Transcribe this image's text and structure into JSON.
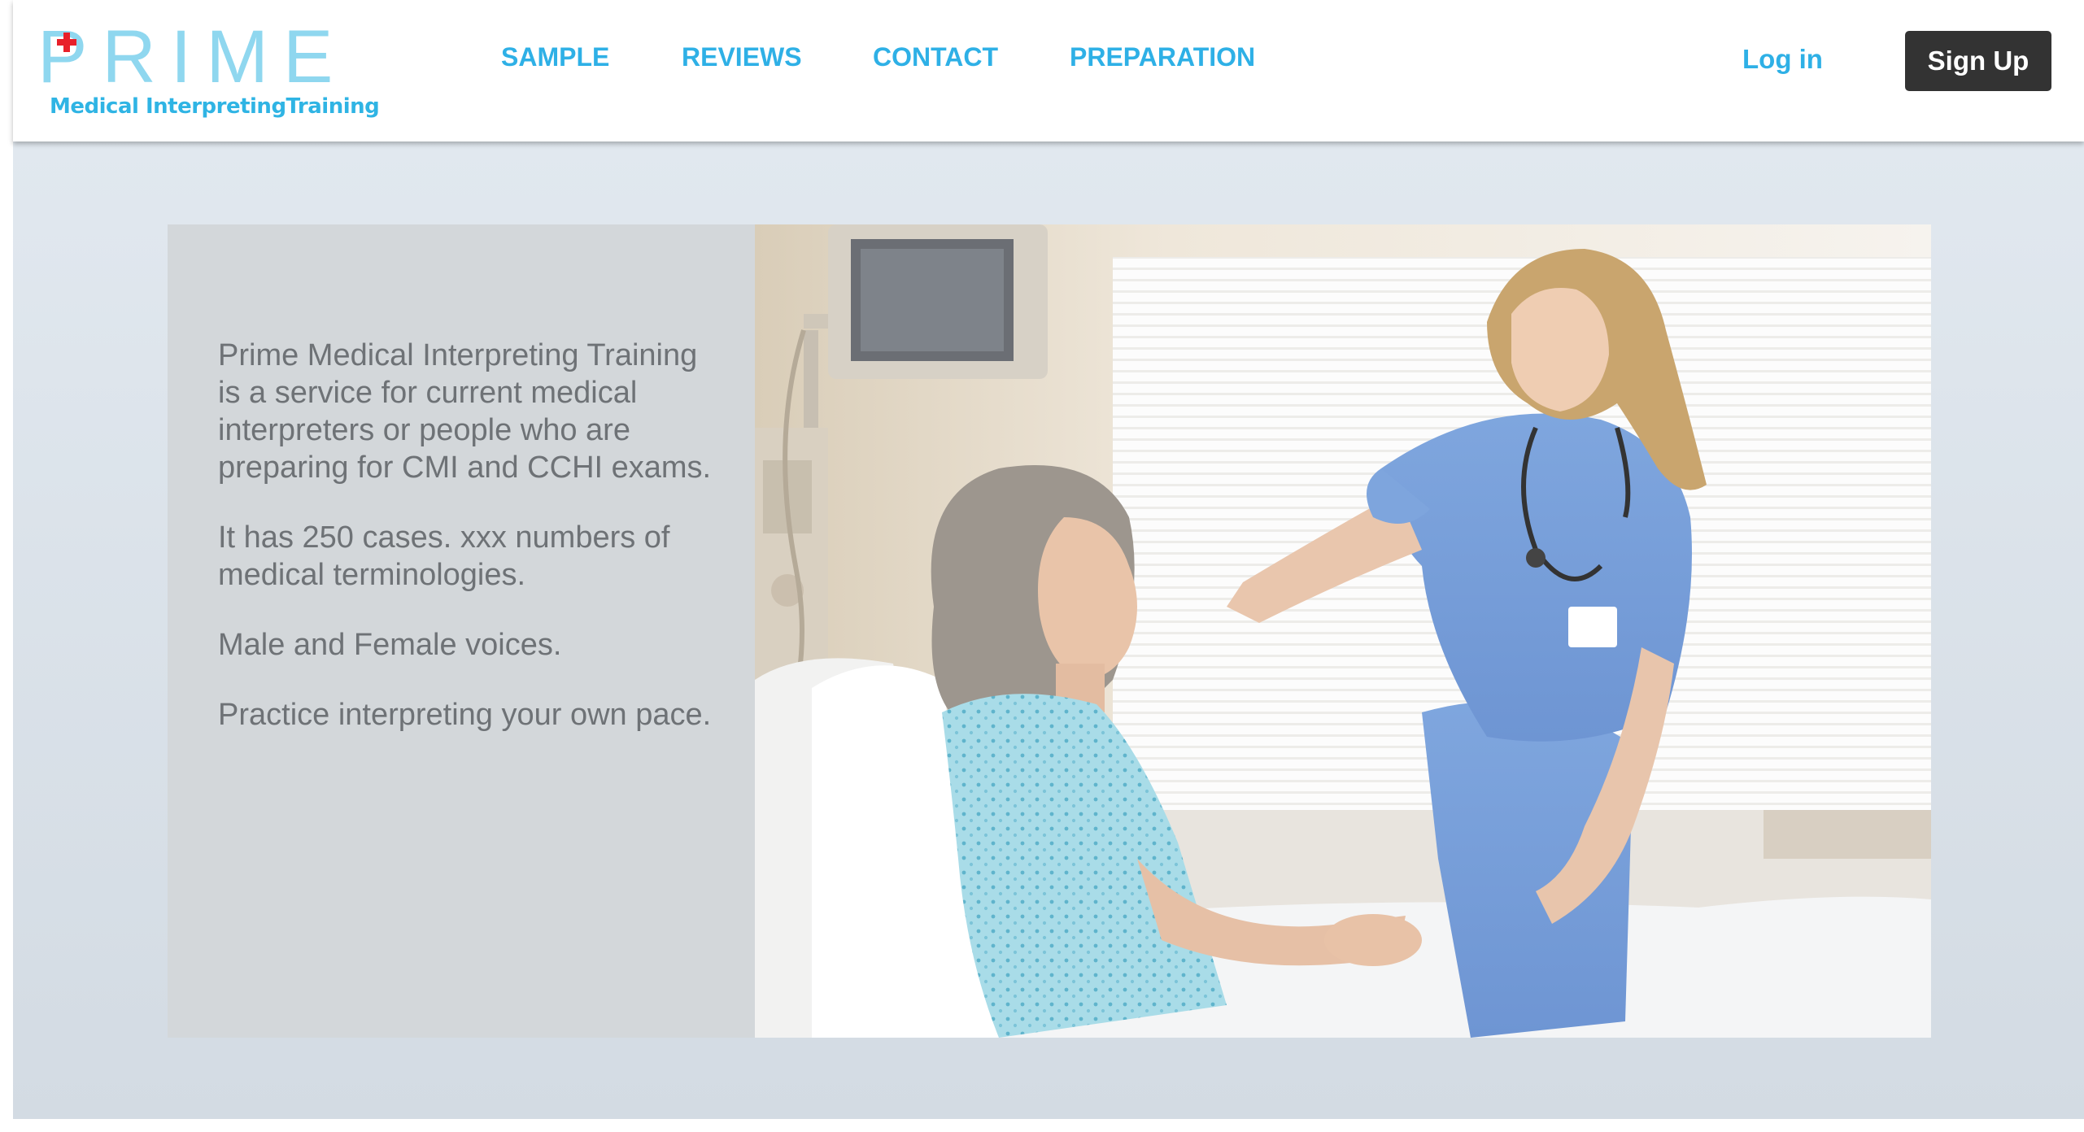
{
  "logo": {
    "word": "PRIME",
    "subtitle": "Medical InterpretingTraining"
  },
  "nav": {
    "items": [
      {
        "label": "SAMPLE"
      },
      {
        "label": "REVIEWS"
      },
      {
        "label": "CONTACT"
      },
      {
        "label": "PREPARATION"
      }
    ],
    "login_label": "Log in",
    "signup_label": "Sign Up"
  },
  "intro": {
    "paragraphs": [
      "Prime Medical Interpreting Training is a service for current medical interpreters or people who are preparing for CMI and CCHI exams.",
      "It has 250 cases. xxx numbers of medical terminologies.",
      "Male and Female voices.",
      "Practice interpreting your own pace."
    ]
  },
  "colors": {
    "accent": "#2eb0e6",
    "logo_light": "#8fd7ef",
    "cross_red": "#e8202a",
    "button_dark": "#333333",
    "body_text": "#6e7276",
    "panel_bg": "#d3d7da"
  }
}
